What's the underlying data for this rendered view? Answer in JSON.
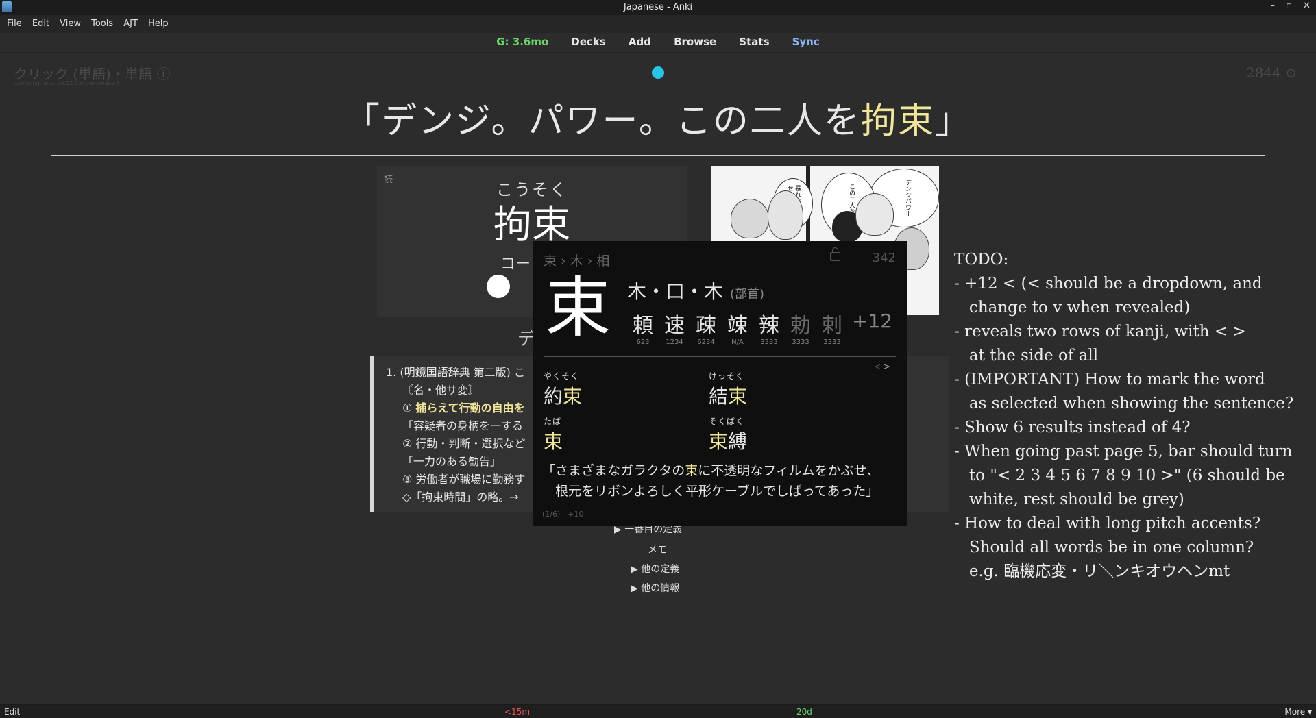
{
  "window": {
    "title": "Japanese - Anki",
    "controls": [
      "–",
      "▫",
      "✕"
    ]
  },
  "menu": [
    "File",
    "Edit",
    "View",
    "Tools",
    "AJT",
    "Help"
  ],
  "toolbar": {
    "due": "G: 3.6mo",
    "decks": "Decks",
    "add": "Add",
    "browse": "Browse",
    "stats": "Stats",
    "sync": "Sync"
  },
  "card_header": {
    "note_type": "クリック (単語)・単語 ⓘ",
    "version": "jp-mining-note: v0.12.0.0-prerelease-8",
    "count": "2844 ⊙"
  },
  "sentence": {
    "before": "「デンジ。パワー。この二人を",
    "highlight": "拘束",
    "after": "」"
  },
  "reading": {
    "tag": "読",
    "kana": "こうそく",
    "word": "拘束",
    "pitch": "コー"
  },
  "definition": {
    "heading": "デ",
    "lines": [
      "1. (明鏡国語辞典 第二版) こ",
      "〘名・他サ変〙",
      "① ",
      "「容疑者の身柄を一する",
      "② 行動・判断・選択など",
      "「一力のある勧告」",
      "③ 労働者が職場に勤務す",
      "◇「拘束時間」の略。→"
    ],
    "highlight": "捕らえて行動の自由を"
  },
  "collapsibles": {
    "first": "▶ 一番目の定義",
    "memo": "メモ",
    "other_defs": "▶ 他の定義",
    "other_info": "▶ 他の情報"
  },
  "popup": {
    "breadcrumb": "束 › 木 › 相",
    "frequency": "342",
    "kanji": "束",
    "components": "木・口・木",
    "components_label": "(部首)",
    "related": [
      {
        "k": "頼",
        "n": "623"
      },
      {
        "k": "速",
        "n": "1234"
      },
      {
        "k": "疎",
        "n": "6234"
      },
      {
        "k": "竦",
        "n": "N/A"
      },
      {
        "k": "辣",
        "n": "3333"
      },
      {
        "k": "勅",
        "n": "3333"
      },
      {
        "k": "剌",
        "n": "3333"
      }
    ],
    "related_more": "+12",
    "nav_prev": "<",
    "nav_next": ">",
    "words": [
      {
        "furi": "やくそく",
        "pre": "約",
        "hl": "束",
        "post": ""
      },
      {
        "furi": "けっそく",
        "pre": "結",
        "hl": "束",
        "post": ""
      },
      {
        "furi": "たば",
        "pre": "",
        "hl": "束",
        "post": ""
      },
      {
        "furi": "そくばく",
        "pre": "",
        "hl": "束",
        "post": "縛"
      }
    ],
    "example": {
      "line1_pre": "「さまざまなガラクタの",
      "line1_hl": "束",
      "line1_post": "に不透明なフィルムをかぶせ、",
      "line2": "　根元をリボンよろしく平形ケーブルでしばってあった」"
    },
    "footer": "(1/6)　+10"
  },
  "manga": {
    "bubble1": "デンジパワー",
    "bubble2": "この二人を拘束",
    "bubble3": "暴れたら殺せ"
  },
  "todo": "TODO:\n- +12 < (< should be a dropdown, and\n   change to v when revealed)\n- reveals two rows of kanji, with < >\n   at the side of all\n- (IMPORTANT) How to mark the word\n   as selected when showing the sentence?\n- Show 6 results instead of 4?\n- When going past page 5, bar should turn\n   to \"< 2 3 4 5 6 7 8 9 10 >\" (6 should be\n   white, rest should be grey)\n- How to deal with long pitch accents?\n   Should all words be in one column?\n   e.g. 臨機応変・リ＼ンキオウヘンmt",
  "statusbar": {
    "edit": "Edit",
    "again": "<15m",
    "good": "20d",
    "more": "More ▾"
  }
}
